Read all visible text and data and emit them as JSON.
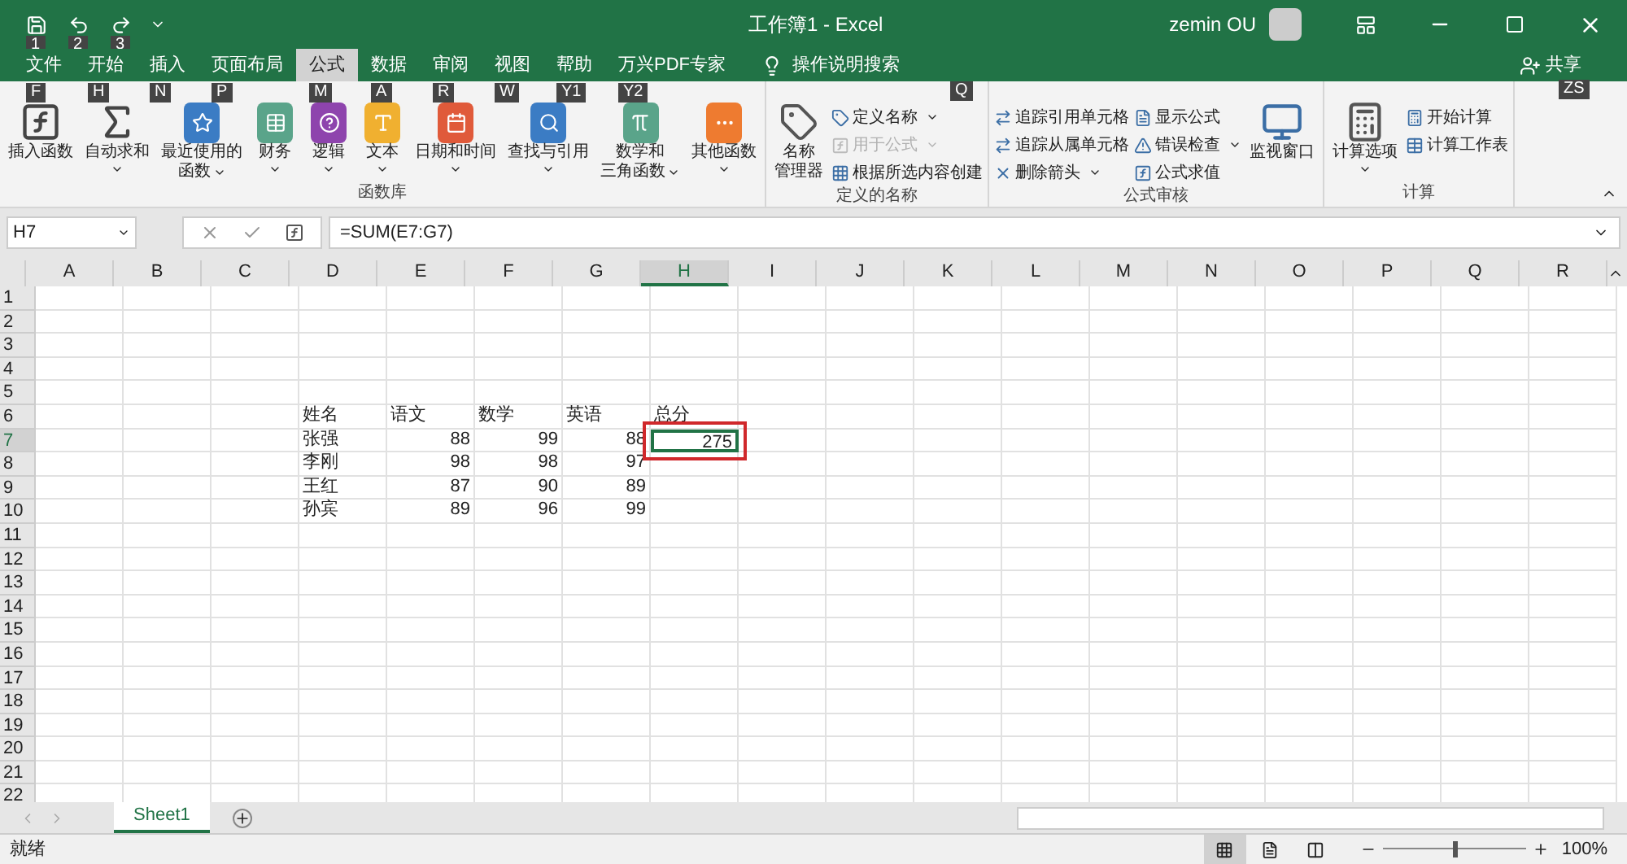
{
  "quick_access": [
    {
      "keytip": "1"
    },
    {
      "keytip": "2"
    },
    {
      "keytip": "3"
    }
  ],
  "window": {
    "title": "工作簿1  -  Excel",
    "user": "zemin OU"
  },
  "tabs": [
    {
      "label": "文件",
      "selected": false,
      "keytip": "F"
    },
    {
      "label": "开始",
      "selected": false,
      "keytip": "H"
    },
    {
      "label": "插入",
      "selected": false,
      "keytip": "N"
    },
    {
      "label": "页面布局",
      "selected": false,
      "keytip": "P"
    },
    {
      "label": "公式",
      "selected": true,
      "keytip": "M"
    },
    {
      "label": "数据",
      "selected": false,
      "keytip": "A"
    },
    {
      "label": "审阅",
      "selected": false,
      "keytip": "R"
    },
    {
      "label": "视图",
      "selected": false,
      "keytip": "W"
    },
    {
      "label": "帮助",
      "selected": false,
      "keytip": "Y1"
    },
    {
      "label": "万兴PDF专家",
      "selected": false,
      "keytip": "Y2"
    }
  ],
  "tell_me": {
    "label": "操作说明搜索",
    "keytip": "Q"
  },
  "share": {
    "label": "共享",
    "keytip": "ZS"
  },
  "ribbon_groups": [
    {
      "title": "函数库",
      "items": [
        {
          "kind": "large",
          "lines": [
            "插入函数"
          ],
          "dropdown": false
        },
        {
          "kind": "large",
          "lines": [
            "自动求和"
          ],
          "dropdown": true
        },
        {
          "kind": "large",
          "lines": [
            "最近使用的",
            "函数"
          ],
          "dropdown": true
        },
        {
          "kind": "large",
          "lines": [
            "财务"
          ],
          "dropdown": true
        },
        {
          "kind": "large",
          "lines": [
            "逻辑"
          ],
          "dropdown": true
        },
        {
          "kind": "large",
          "lines": [
            "文本"
          ],
          "dropdown": true
        },
        {
          "kind": "large",
          "lines": [
            "日期和时间"
          ],
          "dropdown": true
        },
        {
          "kind": "large",
          "lines": [
            "查找与引用"
          ],
          "dropdown": true
        },
        {
          "kind": "large",
          "lines": [
            "数学和",
            "三角函数"
          ],
          "dropdown": true
        },
        {
          "kind": "large",
          "lines": [
            "其他函数"
          ],
          "dropdown": true
        }
      ]
    },
    {
      "title": "定义的名称",
      "items": [
        {
          "kind": "large",
          "lines": [
            "名称",
            "管理器"
          ],
          "dropdown": false
        },
        {
          "kind": "small",
          "label": "定义名称",
          "dropdown": true,
          "disabled": false
        },
        {
          "kind": "small",
          "label": "用于公式",
          "dropdown": true,
          "disabled": true
        },
        {
          "kind": "small",
          "label": "根据所选内容创建",
          "dropdown": false,
          "disabled": false
        }
      ]
    },
    {
      "title": "公式审核",
      "items": [
        {
          "kind": "small",
          "label": "追踪引用单元格",
          "dropdown": false,
          "disabled": false
        },
        {
          "kind": "small",
          "label": "追踪从属单元格",
          "dropdown": false,
          "disabled": false
        },
        {
          "kind": "small",
          "label": "删除箭头",
          "dropdown": true,
          "disabled": false
        },
        {
          "kind": "small",
          "label": "显示公式",
          "dropdown": false,
          "disabled": false
        },
        {
          "kind": "small",
          "label": "错误检查",
          "dropdown": true,
          "disabled": false
        },
        {
          "kind": "small",
          "label": "公式求值",
          "dropdown": false,
          "disabled": false
        },
        {
          "kind": "large",
          "lines": [
            "监视窗口"
          ],
          "dropdown": false
        }
      ]
    },
    {
      "title": "计算",
      "items": [
        {
          "kind": "large",
          "lines": [
            "计算选项"
          ],
          "dropdown": true
        },
        {
          "kind": "small",
          "label": "开始计算",
          "dropdown": false,
          "disabled": false
        },
        {
          "kind": "small",
          "label": "计算工作表",
          "dropdown": false,
          "disabled": false
        }
      ]
    }
  ],
  "formula_bar": {
    "name_box": "H7",
    "formula": "=SUM(E7:G7)"
  },
  "columns": [
    {
      "label": "A",
      "selected": false
    },
    {
      "label": "B",
      "selected": false
    },
    {
      "label": "C",
      "selected": false
    },
    {
      "label": "D",
      "selected": false
    },
    {
      "label": "E",
      "selected": false
    },
    {
      "label": "F",
      "selected": false
    },
    {
      "label": "G",
      "selected": false
    },
    {
      "label": "H",
      "selected": true
    },
    {
      "label": "I",
      "selected": false
    },
    {
      "label": "J",
      "selected": false
    },
    {
      "label": "K",
      "selected": false
    },
    {
      "label": "L",
      "selected": false
    },
    {
      "label": "M",
      "selected": false
    },
    {
      "label": "N",
      "selected": false
    },
    {
      "label": "O",
      "selected": false
    },
    {
      "label": "P",
      "selected": false
    },
    {
      "label": "Q",
      "selected": false
    },
    {
      "label": "R",
      "selected": false
    }
  ],
  "rows": [
    {
      "label": "1",
      "selected": false
    },
    {
      "label": "2",
      "selected": false
    },
    {
      "label": "3",
      "selected": false
    },
    {
      "label": "4",
      "selected": false
    },
    {
      "label": "5",
      "selected": false
    },
    {
      "label": "6",
      "selected": false
    },
    {
      "label": "7",
      "selected": true
    },
    {
      "label": "8",
      "selected": false
    },
    {
      "label": "9",
      "selected": false
    },
    {
      "label": "10",
      "selected": false
    },
    {
      "label": "11",
      "selected": false
    },
    {
      "label": "12",
      "selected": false
    },
    {
      "label": "13",
      "selected": false
    },
    {
      "label": "14",
      "selected": false
    },
    {
      "label": "15",
      "selected": false
    },
    {
      "label": "16",
      "selected": false
    },
    {
      "label": "17",
      "selected": false
    },
    {
      "label": "18",
      "selected": false
    },
    {
      "label": "19",
      "selected": false
    },
    {
      "label": "20",
      "selected": false
    },
    {
      "label": "21",
      "selected": false
    },
    {
      "label": "22",
      "selected": false
    }
  ],
  "table": {
    "header": [
      "姓名",
      "语文",
      "数学",
      "英语",
      "总分"
    ],
    "rows": [
      [
        "张强",
        "88",
        "99",
        "88",
        "275"
      ],
      [
        "李刚",
        "98",
        "98",
        "97"
      ],
      [
        "王红",
        "87",
        "90",
        "89"
      ],
      [
        "孙宾",
        "89",
        "96",
        "99"
      ]
    ]
  },
  "sheets": [
    {
      "label": "Sheet1",
      "selected": true
    }
  ],
  "status_bar": {
    "status": "就绪",
    "zoom": "100%",
    "zoom_level": {
      "level": 0.5
    },
    "views": [
      {
        "selected": true
      },
      {
        "selected": false
      },
      {
        "selected": false
      }
    ]
  }
}
